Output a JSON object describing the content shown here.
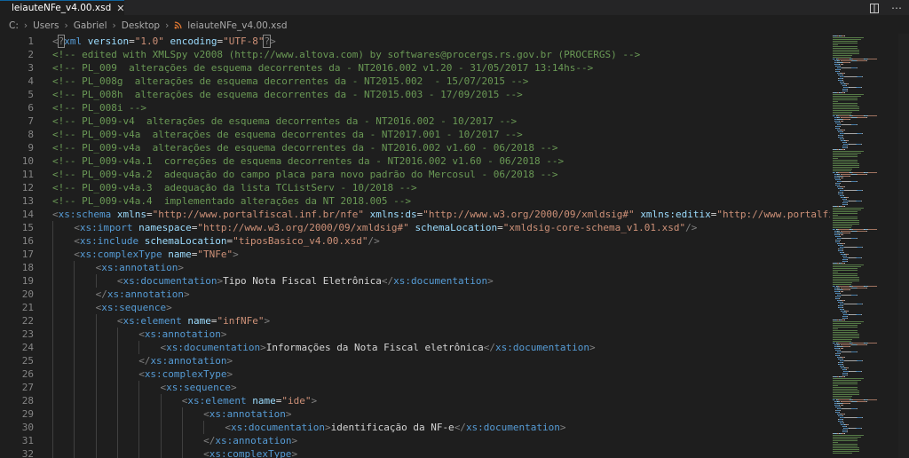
{
  "tab": {
    "filename": "leiauteNFe_v4.00.xsd"
  },
  "breadcrumb": [
    "C:",
    "Users",
    "Gabriel",
    "Desktop",
    "leiauteNFe_v4.00.xsd"
  ],
  "colors": {
    "tag": "#569cd6",
    "attr": "#9cdcfe",
    "value": "#ce9178",
    "comment": "#6a9955",
    "text": "#d4d4d4",
    "punct": "#808080",
    "lineNumber": "#858585",
    "background": "#1e1e1e"
  },
  "lines": [
    {
      "n": "1",
      "indent": 0,
      "tokens": [
        [
          "punct",
          "<"
        ],
        [
          "punct",
          "?"
        ],
        [
          "tag",
          "xml"
        ],
        [
          "text",
          " "
        ],
        [
          "attr",
          "version"
        ],
        [
          "text",
          "="
        ],
        [
          "val",
          "\"1.0\""
        ],
        [
          "text",
          " "
        ],
        [
          "attr",
          "encoding"
        ],
        [
          "text",
          "="
        ],
        [
          "val",
          "\"UTF-8\""
        ],
        [
          "punct",
          "?"
        ],
        [
          "punct",
          ">"
        ]
      ]
    },
    {
      "n": "2",
      "indent": 0,
      "tokens": [
        [
          "cm",
          "<!-- edited with XMLSpy v2008 (http://www.altova.com) by softwares@procergs.rs.gov.br (PROCERGS) -->"
        ]
      ]
    },
    {
      "n": "3",
      "indent": 0,
      "tokens": [
        [
          "cm",
          "<!-- PL_009  alterações de esquema decorrentes da - NT2016.002 v1.20 - 31/05/2017 13:14hs-->"
        ]
      ]
    },
    {
      "n": "4",
      "indent": 0,
      "tokens": [
        [
          "cm",
          "<!-- PL_008g  alterações de esquema decorrentes da - NT2015.002  - 15/07/2015 -->"
        ]
      ]
    },
    {
      "n": "5",
      "indent": 0,
      "tokens": [
        [
          "cm",
          "<!-- PL_008h  alterações de esquema decorrentes da - NT2015.003 - 17/09/2015 -->"
        ]
      ]
    },
    {
      "n": "6",
      "indent": 0,
      "tokens": [
        [
          "cm",
          "<!-- PL_008i -->"
        ]
      ]
    },
    {
      "n": "7",
      "indent": 0,
      "tokens": [
        [
          "cm",
          "<!-- PL_009-v4  alterações de esquema decorrentes da - NT2016.002 - 10/2017 -->"
        ]
      ]
    },
    {
      "n": "8",
      "indent": 0,
      "tokens": [
        [
          "cm",
          "<!-- PL_009-v4a  alterações de esquema decorrentes da - NT2017.001 - 10/2017 -->"
        ]
      ]
    },
    {
      "n": "9",
      "indent": 0,
      "tokens": [
        [
          "cm",
          "<!-- PL_009-v4a  alterações de esquema decorrentes da - NT2016.002 v1.60 - 06/2018 -->"
        ]
      ]
    },
    {
      "n": "10",
      "indent": 0,
      "tokens": [
        [
          "cm",
          "<!-- PL_009-v4a.1  correções de esquema decorrentes da - NT2016.002 v1.60 - 06/2018 -->"
        ]
      ]
    },
    {
      "n": "11",
      "indent": 0,
      "tokens": [
        [
          "cm",
          "<!-- PL_009-v4a.2  adequação do campo placa para novo padrão do Mercosul - 06/2018 -->"
        ]
      ]
    },
    {
      "n": "12",
      "indent": 0,
      "tokens": [
        [
          "cm",
          "<!-- PL_009-v4a.3  adequação da lista TCListServ - 10/2018 -->"
        ]
      ]
    },
    {
      "n": "13",
      "indent": 0,
      "tokens": [
        [
          "cm",
          "<!-- PL_009-v4a.4  implementado alterações da NT 2018.005 -->"
        ]
      ]
    },
    {
      "n": "14",
      "indent": 0,
      "tokens": [
        [
          "punct",
          "<"
        ],
        [
          "tag",
          "xs:schema"
        ],
        [
          "text",
          " "
        ],
        [
          "attr",
          "xmlns"
        ],
        [
          "text",
          "="
        ],
        [
          "val",
          "\"http://www.portalfiscal.inf.br/nfe\""
        ],
        [
          "text",
          " "
        ],
        [
          "attr",
          "xmlns:ds"
        ],
        [
          "text",
          "="
        ],
        [
          "val",
          "\"http://www.w3.org/2000/09/xmldsig#\""
        ],
        [
          "text",
          " "
        ],
        [
          "attr",
          "xmlns:editix"
        ],
        [
          "text",
          "="
        ],
        [
          "val",
          "\"http://www.portalfiscal.inf.br"
        ]
      ]
    },
    {
      "n": "15",
      "indent": 1,
      "tokens": [
        [
          "punct",
          "<"
        ],
        [
          "tag",
          "xs:import"
        ],
        [
          "text",
          " "
        ],
        [
          "attr",
          "namespace"
        ],
        [
          "text",
          "="
        ],
        [
          "val",
          "\"http://www.w3.org/2000/09/xmldsig#\""
        ],
        [
          "text",
          " "
        ],
        [
          "attr",
          "schemaLocation"
        ],
        [
          "text",
          "="
        ],
        [
          "val",
          "\"xmldsig-core-schema_v1.01.xsd\""
        ],
        [
          "punct",
          "/>"
        ]
      ]
    },
    {
      "n": "16",
      "indent": 1,
      "tokens": [
        [
          "punct",
          "<"
        ],
        [
          "tag",
          "xs:include"
        ],
        [
          "text",
          " "
        ],
        [
          "attr",
          "schemaLocation"
        ],
        [
          "text",
          "="
        ],
        [
          "val",
          "\"tiposBasico_v4.00.xsd\""
        ],
        [
          "punct",
          "/>"
        ]
      ]
    },
    {
      "n": "17",
      "indent": 1,
      "tokens": [
        [
          "punct",
          "<"
        ],
        [
          "tag",
          "xs:complexType"
        ],
        [
          "text",
          " "
        ],
        [
          "attr",
          "name"
        ],
        [
          "text",
          "="
        ],
        [
          "val",
          "\"TNFe\""
        ],
        [
          "punct",
          ">"
        ]
      ]
    },
    {
      "n": "18",
      "indent": 2,
      "tokens": [
        [
          "punct",
          "<"
        ],
        [
          "tag",
          "xs:annotation"
        ],
        [
          "punct",
          ">"
        ]
      ]
    },
    {
      "n": "19",
      "indent": 3,
      "tokens": [
        [
          "punct",
          "<"
        ],
        [
          "tag",
          "xs:documentation"
        ],
        [
          "punct",
          ">"
        ],
        [
          "text",
          "Tipo Nota Fiscal Eletrônica"
        ],
        [
          "punct",
          "</"
        ],
        [
          "tag",
          "xs:documentation"
        ],
        [
          "punct",
          ">"
        ]
      ]
    },
    {
      "n": "20",
      "indent": 2,
      "tokens": [
        [
          "punct",
          "</"
        ],
        [
          "tag",
          "xs:annotation"
        ],
        [
          "punct",
          ">"
        ]
      ]
    },
    {
      "n": "21",
      "indent": 2,
      "tokens": [
        [
          "punct",
          "<"
        ],
        [
          "tag",
          "xs:sequence"
        ],
        [
          "punct",
          ">"
        ]
      ]
    },
    {
      "n": "22",
      "indent": 3,
      "tokens": [
        [
          "punct",
          "<"
        ],
        [
          "tag",
          "xs:element"
        ],
        [
          "text",
          " "
        ],
        [
          "attr",
          "name"
        ],
        [
          "text",
          "="
        ],
        [
          "val",
          "\"infNFe\""
        ],
        [
          "punct",
          ">"
        ]
      ]
    },
    {
      "n": "23",
      "indent": 4,
      "tokens": [
        [
          "punct",
          "<"
        ],
        [
          "tag",
          "xs:annotation"
        ],
        [
          "punct",
          ">"
        ]
      ]
    },
    {
      "n": "24",
      "indent": 5,
      "tokens": [
        [
          "punct",
          "<"
        ],
        [
          "tag",
          "xs:documentation"
        ],
        [
          "punct",
          ">"
        ],
        [
          "text",
          "Informações da Nota Fiscal eletrônica"
        ],
        [
          "punct",
          "</"
        ],
        [
          "tag",
          "xs:documentation"
        ],
        [
          "punct",
          ">"
        ]
      ]
    },
    {
      "n": "25",
      "indent": 4,
      "tokens": [
        [
          "punct",
          "</"
        ],
        [
          "tag",
          "xs:annotation"
        ],
        [
          "punct",
          ">"
        ]
      ]
    },
    {
      "n": "26",
      "indent": 4,
      "tokens": [
        [
          "punct",
          "<"
        ],
        [
          "tag",
          "xs:complexType"
        ],
        [
          "punct",
          ">"
        ]
      ]
    },
    {
      "n": "27",
      "indent": 5,
      "tokens": [
        [
          "punct",
          "<"
        ],
        [
          "tag",
          "xs:sequence"
        ],
        [
          "punct",
          ">"
        ]
      ]
    },
    {
      "n": "28",
      "indent": 6,
      "tokens": [
        [
          "punct",
          "<"
        ],
        [
          "tag",
          "xs:element"
        ],
        [
          "text",
          " "
        ],
        [
          "attr",
          "name"
        ],
        [
          "text",
          "="
        ],
        [
          "val",
          "\"ide\""
        ],
        [
          "punct",
          ">"
        ]
      ]
    },
    {
      "n": "29",
      "indent": 7,
      "tokens": [
        [
          "punct",
          "<"
        ],
        [
          "tag",
          "xs:annotation"
        ],
        [
          "punct",
          ">"
        ]
      ]
    },
    {
      "n": "30",
      "indent": 8,
      "tokens": [
        [
          "punct",
          "<"
        ],
        [
          "tag",
          "xs:documentation"
        ],
        [
          "punct",
          ">"
        ],
        [
          "text",
          "identificação da NF-e"
        ],
        [
          "punct",
          "</"
        ],
        [
          "tag",
          "xs:documentation"
        ],
        [
          "punct",
          ">"
        ]
      ]
    },
    {
      "n": "31",
      "indent": 7,
      "tokens": [
        [
          "punct",
          "</"
        ],
        [
          "tag",
          "xs:annotation"
        ],
        [
          "punct",
          ">"
        ]
      ]
    },
    {
      "n": "32",
      "indent": 7,
      "tokens": [
        [
          "punct",
          "<"
        ],
        [
          "tag",
          "xs:complexType"
        ],
        [
          "punct",
          ">"
        ]
      ]
    }
  ]
}
